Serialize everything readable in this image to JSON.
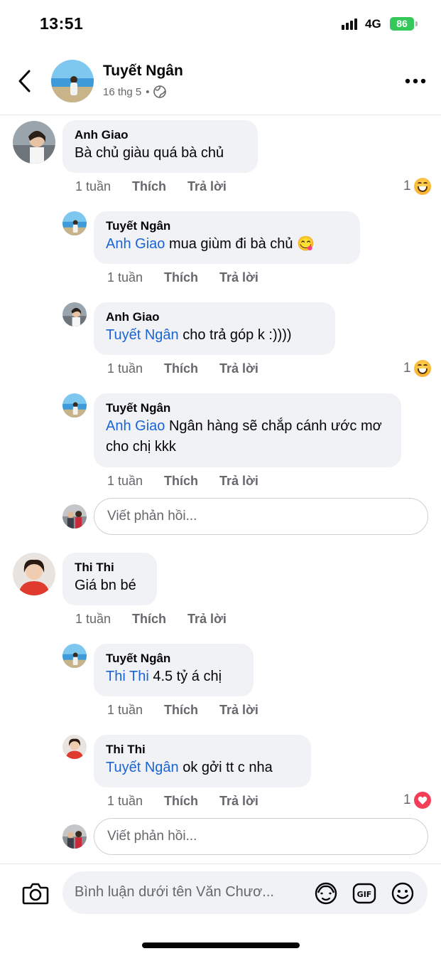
{
  "status_bar": {
    "time": "13:51",
    "network": "4G",
    "battery": "86"
  },
  "header": {
    "name": "Tuyết Ngân",
    "date": "16 thg 5",
    "separator": "•"
  },
  "actions_labels": {
    "like": "Thích",
    "reply": "Trả lời"
  },
  "comments": [
    {
      "author": "Anh Giao",
      "text": "Bà chủ giàu quá bà chủ",
      "time": "1 tuần",
      "reaction_count": "1"
    },
    {
      "author": "Tuyết Ngân",
      "mention": "Anh Giao",
      "text": " mua giùm đi bà chủ 😋",
      "time": "1 tuần"
    },
    {
      "author": "Anh Giao",
      "mention": "Tuyết Ngân",
      "text": " cho trả góp k :))))",
      "time": "1 tuần",
      "reaction_count": "1"
    },
    {
      "author": "Tuyết Ngân",
      "mention": "Anh Giao",
      "text": " Ngân hàng sẽ chắp cánh ước mơ cho chị kkk",
      "time": "1 tuần"
    },
    {
      "author": "Thi Thi",
      "text": "Giá bn bé",
      "time": "1 tuần"
    },
    {
      "author": "Tuyết Ngân",
      "mention": "Thi Thi",
      "text": " 4.5 tỷ á chị",
      "time": "1 tuần"
    },
    {
      "author": "Thi Thi",
      "mention": "Tuyết Ngân",
      "text": " ok gởi tt c nha",
      "time": "1 tuần",
      "reaction_count": "1"
    }
  ],
  "reply_placeholder": "Viết phản hồi...",
  "composer": {
    "placeholder": "Bình luận dưới tên Văn Chươ..."
  },
  "icons": [
    "back-icon",
    "globe-icon",
    "more-icon",
    "camera-icon",
    "avatar-sticker-icon",
    "gif-icon",
    "emoji-icon",
    "haha-icon",
    "love-icon"
  ],
  "colors": {
    "mention": "#1a64d6",
    "bubble": "#f0f2f5",
    "battery": "#34c759",
    "love": "#f33e58"
  }
}
